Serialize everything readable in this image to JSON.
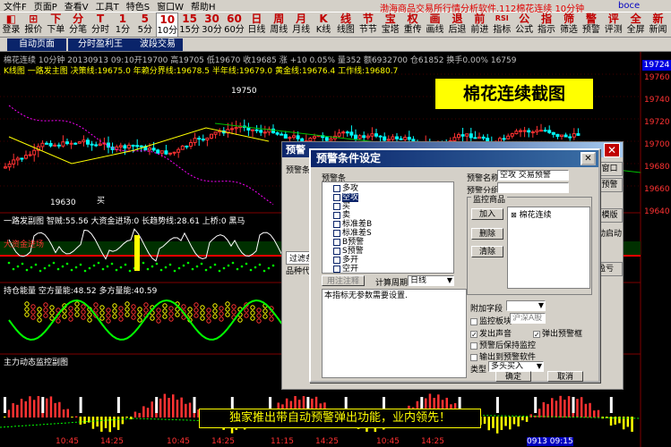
{
  "menubar": {
    "items": [
      "文件F",
      "页面P",
      "查看V",
      "工具T",
      "特色S",
      "窗口W",
      "帮助H"
    ],
    "title": "渤海商品交易所行情分析软件.112棉花连续 10分钟",
    "brand": "boce"
  },
  "toolbar": {
    "items": [
      {
        "icon": "◧",
        "label": "登录"
      },
      {
        "icon": "⊞",
        "label": "报价"
      },
      {
        "icon": "下",
        "label": "下单"
      },
      {
        "icon": "分",
        "label": "分笔"
      },
      {
        "icon": "T",
        "label": "分时"
      },
      {
        "icon": "1",
        "label": "1分"
      },
      {
        "icon": "5",
        "label": "5分"
      },
      {
        "icon": "10",
        "label": "10分"
      },
      {
        "icon": "15",
        "label": "15分"
      },
      {
        "icon": "30",
        "label": "30分"
      },
      {
        "icon": "60",
        "label": "60分"
      },
      {
        "icon": "日",
        "label": "日线"
      },
      {
        "icon": "周",
        "label": "周线"
      },
      {
        "icon": "月",
        "label": "月线"
      },
      {
        "icon": "K",
        "label": "K线"
      },
      {
        "icon": "线",
        "label": "线图"
      },
      {
        "icon": "节",
        "label": "节节"
      },
      {
        "icon": "宝",
        "label": "宝塔"
      },
      {
        "icon": "权",
        "label": "重传"
      },
      {
        "icon": "画",
        "label": "画线"
      },
      {
        "icon": "退",
        "label": "后退"
      },
      {
        "icon": "前",
        "label": "前进"
      },
      {
        "icon": "RSI",
        "label": "指标"
      },
      {
        "icon": "公",
        "label": "公式"
      },
      {
        "icon": "指",
        "label": "指示"
      },
      {
        "icon": "筛",
        "label": "筛选"
      },
      {
        "icon": "警",
        "label": "预警"
      },
      {
        "icon": "评",
        "label": "评测"
      },
      {
        "icon": "全",
        "label": "全屏"
      },
      {
        "icon": "新",
        "label": "新闻"
      }
    ]
  },
  "tabs": [
    "自动页面",
    "分时盈利王",
    "波段交易"
  ],
  "chart": {
    "header": "棉花连续 10分钟 20130913 09:10开19700 高19705 低19670 收19685 涨 +10 0.05% 量352 额6932700 仓61852 换手0.00% 16759",
    "ma_line": "K线图 一路发主图 决策线:19675.0 年赖分界线:19678.5 半年线:19679.0 黄金线:19676.4 工作线:19680.7",
    "ind1": "一路发副图 智贼:55.56 大资金进场:0 长趋势线:28.61 上桥:0 黑马",
    "ind1_tag": "大资金进场",
    "ind2": "持仓能量 空方量能:48.52 多方量能:40.59",
    "ind3": "主力动态监控副图",
    "hi_label": "19750",
    "lo_label": "19630",
    "buy_label": "买",
    "price_tag": "19724",
    "axis": [
      "19760",
      "19740",
      "19720",
      "19700",
      "19680",
      "19660",
      "19640"
    ],
    "time_axis": [
      "10:45",
      "14:25",
      "10:45",
      "14:25",
      "11:15",
      "14:25",
      "10:45",
      "14:25",
      "0913 09:15"
    ],
    "snapshot_title": "棉花连续截图",
    "banner": "独家推出带自动预警弹出功能，业内领先！"
  },
  "bg_window": {
    "title": "预警",
    "label1": "预警条件",
    "tabs": [
      "过滤条",
      "品种代码"
    ],
    "buttons": [
      "闭窗口",
      "止预警",
      "入模版",
      "自动启动",
      "盈亏"
    ]
  },
  "dialog": {
    "title": "预警条件设定",
    "cond_label": "预警条",
    "conditions": [
      "多攻",
      "空攻",
      "买",
      "卖",
      "标准差B",
      "标准差S",
      "B预警",
      "S预警",
      "多开",
      "空开"
    ],
    "selected_condition": "空攻",
    "use_note_button": "用注注释",
    "period_label": "计算周期",
    "period_value": "日线",
    "description": "本指标无参数需要设置.",
    "name_label": "预警名称",
    "name_value": "空攻 交易预警",
    "group_label": "预警分组",
    "group_value": "",
    "monitor_label": "监控商品",
    "monitor_items": [
      "棉花连续"
    ],
    "add_button": "加入",
    "delete_button": "删除",
    "clear_button": "清除",
    "extra_label": "附加字段",
    "check_block": "监控板块",
    "check_block_value": "沪深A股",
    "check_sound": "发出声音",
    "check_popup": "弹出预警框",
    "check_keep": "预警后保持监控",
    "check_output": "输出到预警软件",
    "type_label": "类型",
    "type_value": "多头买入",
    "ok_button": "确定",
    "cancel_button": "取消"
  },
  "colors": {
    "up": "#ff3232",
    "down": "#00ffff",
    "accent": "#ffff00",
    "bg": "#000000"
  }
}
